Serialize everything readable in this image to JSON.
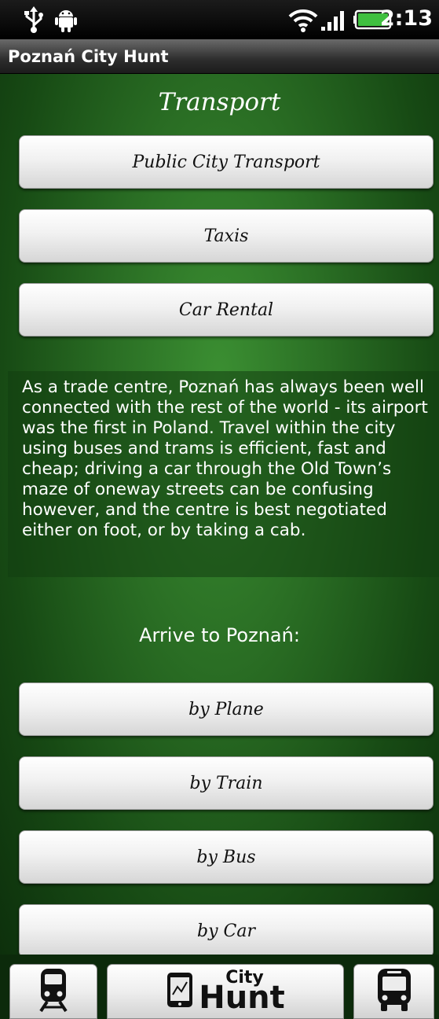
{
  "status_bar": {
    "time": "2:13",
    "icons": [
      "usb-icon",
      "android-icon",
      "wifi-icon",
      "signal-icon",
      "battery-icon"
    ],
    "battery_color": "#40c040"
  },
  "app": {
    "title": "Poznań City Hunt"
  },
  "main": {
    "heading": "Transport",
    "buttons": [
      {
        "label": "Public City Transport"
      },
      {
        "label": "Taxis"
      },
      {
        "label": "Car Rental"
      }
    ],
    "description": "As a trade centre, Poznań has always been well connected with the rest of the world - its airport was the first in Poland. Travel within the city using buses and trams is efficient, fast and cheap; driving a car through the Old Town’s maze of oneway streets can be confusing however, and the centre is best negotiated either on foot, or by taking a cab.",
    "arrive_heading": "Arrive to Poznań:",
    "arrive_buttons": [
      {
        "label": "by Plane"
      },
      {
        "label": "by Train"
      },
      {
        "label": "by Bus"
      },
      {
        "label": "by Car"
      }
    ]
  },
  "bottom_bar": {
    "left_icon": "train-icon",
    "logo_small": "City",
    "logo_big": "Hunt",
    "logo_icon": "phone-map-icon",
    "right_icon": "bus-icon"
  },
  "colors": {
    "background_green": "#2a6e24",
    "button_face": "#f1f1f1"
  }
}
